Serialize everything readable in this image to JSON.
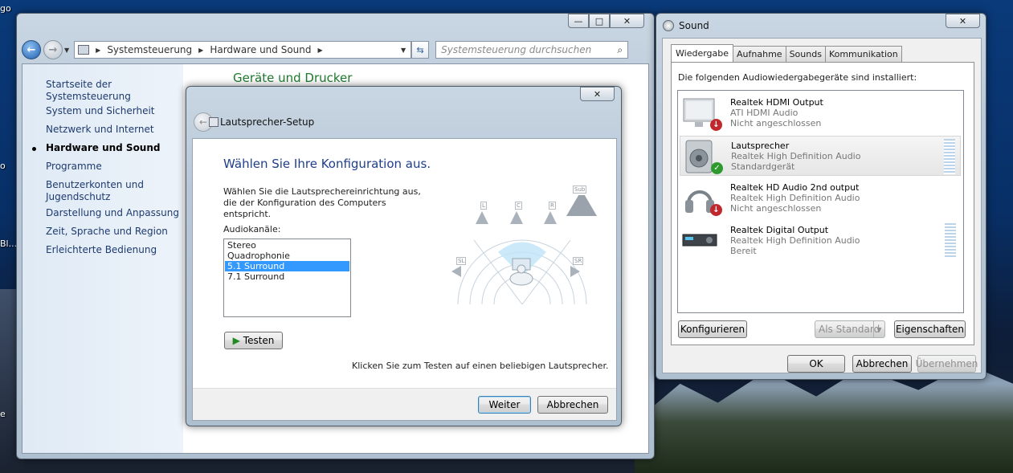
{
  "desktop": {
    "fragments": [
      "go",
      "o",
      "Bl...",
      "e"
    ]
  },
  "control_panel": {
    "address": {
      "crumb1": "Systemsteuerung",
      "crumb2": "Hardware und Sound"
    },
    "search_placeholder": "Systemsteuerung durchsuchen",
    "sidebar": [
      {
        "label": "Startseite der Systemsteuerung"
      },
      {
        "label": "System und Sicherheit"
      },
      {
        "label": "Netzwerk und Internet"
      },
      {
        "label": "Hardware und Sound",
        "active": true
      },
      {
        "label": "Programme"
      },
      {
        "label": "Benutzerkonten und Jugendschutz"
      },
      {
        "label": "Darstellung und Anpassung"
      },
      {
        "label": "Zeit, Sprache und Region"
      },
      {
        "label": "Erleichterte Bedienung"
      }
    ],
    "main_heading": "Geräte und Drucker"
  },
  "speaker_setup": {
    "title": "Lautsprecher-Setup",
    "heading": "Wählen Sie Ihre Konfiguration aus.",
    "description": "Wählen Sie die Lautsprechereinrichtung aus, die der Konfiguration des Computers entspricht.",
    "channels_label": "Audiokanäle:",
    "channels": [
      "Stereo",
      "Quadrophonie",
      "5.1 Surround",
      "7.1 Surround"
    ],
    "selected_channel": "5.1 Surround",
    "test_button": "Testen",
    "hint": "Klicken Sie zum Testen auf einen beliebigen Lautsprecher.",
    "speaker_labels": {
      "l": "L",
      "c": "C",
      "r": "R",
      "sub": "Sub",
      "sl": "SL",
      "sr": "SR"
    },
    "next_button": "Weiter",
    "cancel_button": "Abbrechen"
  },
  "sound": {
    "title": "Sound",
    "tabs": [
      "Wiedergabe",
      "Aufnahme",
      "Sounds",
      "Kommunikation"
    ],
    "active_tab": "Wiedergabe",
    "description": "Die folgenden Audiowiedergabegeräte sind installiert:",
    "devices": [
      {
        "name": "Realtek HDMI Output",
        "driver": "ATI HDMI Audio",
        "status": "Nicht angeschlossen",
        "icon": "monitor-icon",
        "badge": "disconnected"
      },
      {
        "name": "Lautsprecher",
        "driver": "Realtek High Definition Audio",
        "status": "Standardgerät",
        "icon": "speaker-icon",
        "badge": "default"
      },
      {
        "name": "Realtek HD Audio 2nd output",
        "driver": "Realtek High Definition Audio",
        "status": "Nicht angeschlossen",
        "icon": "headphones-icon",
        "badge": "disconnected"
      },
      {
        "name": "Realtek Digital Output",
        "driver": "Realtek High Definition Audio",
        "status": "Bereit",
        "icon": "receiver-icon",
        "badge": "none"
      }
    ],
    "configure_button": "Konfigurieren",
    "set_default_button": "Als Standard",
    "properties_button": "Eigenschaften",
    "ok_button": "OK",
    "cancel_button": "Abbrechen",
    "apply_button": "Übernehmen"
  },
  "colors": {
    "accent": "#3399ff",
    "heading_blue": "#1e3e8c",
    "link": "#1e3a6e",
    "ok_green": "#2e9a2e",
    "error_red": "#c0282d"
  }
}
